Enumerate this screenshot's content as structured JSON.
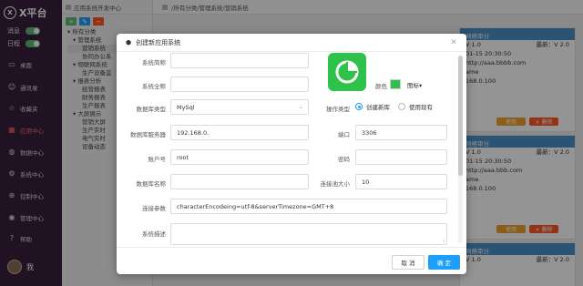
{
  "sidebar": {
    "logo_mark": "X",
    "logo_text": "X平台",
    "toggles": [
      {
        "label": "消息"
      },
      {
        "label": "日程"
      }
    ],
    "nav": [
      {
        "label": "桌面",
        "icon": "desktop-icon"
      },
      {
        "label": "通讯录",
        "icon": "contacts-icon"
      },
      {
        "label": "收藏夹",
        "icon": "star-icon"
      },
      {
        "label": "应用中心",
        "icon": "apps-icon",
        "active": true
      },
      {
        "label": "数据中心",
        "icon": "data-icon"
      },
      {
        "label": "系统中心",
        "icon": "settings-icon"
      },
      {
        "label": "控制中心",
        "icon": "control-icon"
      },
      {
        "label": "管理中心",
        "icon": "manage-icon"
      },
      {
        "label": "帮助",
        "icon": "help-icon"
      }
    ],
    "user_label": "我"
  },
  "tree": {
    "title": "应用系统开发中心",
    "nodes": [
      "所有分类",
      "管理系统",
      "营销系统",
      "协同办公系",
      "物联网系统",
      "生产设备监",
      "报表分析",
      "经营报表",
      "财务报表",
      "生产报表",
      "大屏展示",
      "营销大屏",
      "生产实时",
      "电气实时",
      "设备动态"
    ]
  },
  "breadcrumb": "/所有分类/管理系统/营销系统",
  "cards": [
    {
      "title": "网络审分",
      "version": "V 1.0",
      "latest": "最新：V 2.0",
      "date": "01-15 20:30:50",
      "url": "http://aaa.bbbb.com",
      "name": "ame",
      "ip": "168.0.100",
      "use_label": "使用",
      "delete_label": "× 删除"
    },
    {
      "title": "网络审分",
      "version": "V 1.0",
      "latest": "最新：V 2.0",
      "date": "01-15 20:30:50",
      "url": "http://aaa.bbb.com",
      "name": "ame",
      "ip": "168.0.100",
      "use_label": "使用",
      "delete_label": "× 删除"
    },
    {
      "title": "网络审分",
      "version": "V 1.0",
      "latest": "最新：V 2.0",
      "date": "",
      "url": "",
      "name": "",
      "ip": "",
      "use_label": "",
      "delete_label": ""
    }
  ],
  "modal": {
    "title": "创建新应用系统",
    "fields": {
      "system_short_name": {
        "label": "系统简称",
        "value": ""
      },
      "system_full_name": {
        "label": "系统全称",
        "value": ""
      },
      "db_type": {
        "label": "数据库类型",
        "value": "MySql"
      },
      "db_server": {
        "label": "数据库服务器",
        "value": "192.168.0."
      },
      "account": {
        "label": "账户号",
        "value": "root"
      },
      "db_name": {
        "label": "数据库名称",
        "value": ""
      },
      "conn_params": {
        "label": "连接参数",
        "value": "characterEncodeing=utf-8&serverTimezone=GMT+8"
      },
      "system_desc": {
        "label": "系统描述",
        "value": ""
      },
      "port": {
        "label": "端口",
        "value": "3306"
      },
      "password": {
        "label": "密码",
        "value": ""
      },
      "pool_size": {
        "label": "连接池大小",
        "value": "10"
      }
    },
    "color_label": "颜色",
    "icon_label": "图标",
    "accent_color": "#2ec24a",
    "operation": {
      "label": "操作类型",
      "options": [
        {
          "label": "创建新库",
          "checked": true
        },
        {
          "label": "使用现有",
          "checked": false
        }
      ]
    },
    "cancel_label": "取 消",
    "ok_label": "确 定"
  }
}
